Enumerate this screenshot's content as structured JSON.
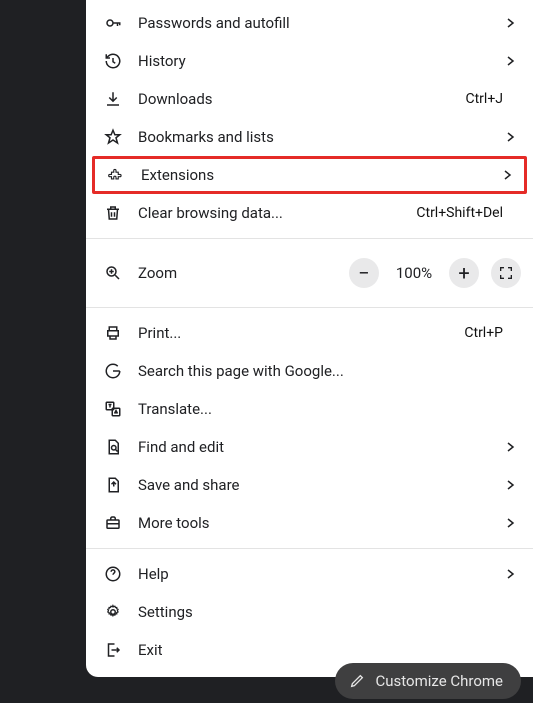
{
  "menu": {
    "groups": [
      [
        {
          "id": "passwords",
          "label": "Passwords and autofill",
          "submenu": true,
          "shortcut": ""
        },
        {
          "id": "history",
          "label": "History",
          "submenu": true,
          "shortcut": ""
        },
        {
          "id": "downloads",
          "label": "Downloads",
          "submenu": false,
          "shortcut": "Ctrl+J"
        },
        {
          "id": "bookmarks",
          "label": "Bookmarks and lists",
          "submenu": true,
          "shortcut": ""
        },
        {
          "id": "extensions",
          "label": "Extensions",
          "submenu": true,
          "shortcut": "",
          "highlighted": true
        },
        {
          "id": "clear-data",
          "label": "Clear browsing data...",
          "submenu": false,
          "shortcut": "Ctrl+Shift+Del"
        }
      ],
      [
        {
          "id": "print",
          "label": "Print...",
          "submenu": false,
          "shortcut": "Ctrl+P"
        },
        {
          "id": "search-google",
          "label": "Search this page with Google...",
          "submenu": false,
          "shortcut": ""
        },
        {
          "id": "translate",
          "label": "Translate...",
          "submenu": false,
          "shortcut": ""
        },
        {
          "id": "find-edit",
          "label": "Find and edit",
          "submenu": true,
          "shortcut": ""
        },
        {
          "id": "save-share",
          "label": "Save and share",
          "submenu": true,
          "shortcut": ""
        },
        {
          "id": "more-tools",
          "label": "More tools",
          "submenu": true,
          "shortcut": ""
        }
      ],
      [
        {
          "id": "help",
          "label": "Help",
          "submenu": true,
          "shortcut": ""
        },
        {
          "id": "settings",
          "label": "Settings",
          "submenu": false,
          "shortcut": ""
        },
        {
          "id": "exit",
          "label": "Exit",
          "submenu": false,
          "shortcut": ""
        }
      ]
    ],
    "zoom": {
      "label": "Zoom",
      "minus": "−",
      "plus": "+",
      "value": "100%"
    }
  },
  "customize": {
    "label": "Customize Chrome"
  }
}
